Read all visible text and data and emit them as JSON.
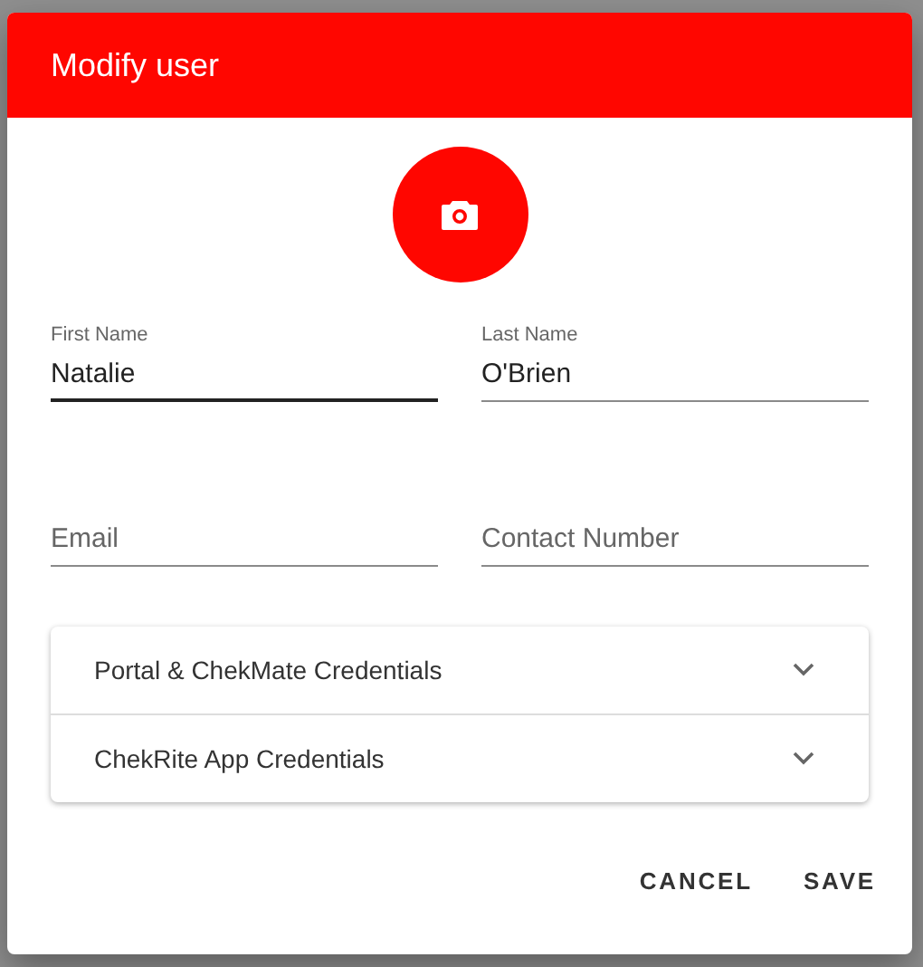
{
  "dialog": {
    "title": "Modify user",
    "fields": [
      {
        "label": "First Name",
        "value": "Natalie",
        "focused": true
      },
      {
        "label": "Last Name",
        "value": "O'Brien",
        "focused": false
      },
      {
        "placeholder": "Email",
        "focused": false
      },
      {
        "placeholder": "Contact Number",
        "focused": false
      }
    ],
    "panels": [
      {
        "title": "Portal & ChekMate Credentials",
        "expanded": false
      },
      {
        "title": "ChekRite App Credentials",
        "expanded": false
      }
    ],
    "buttons": [
      "CANCEL",
      "SAVE"
    ]
  }
}
